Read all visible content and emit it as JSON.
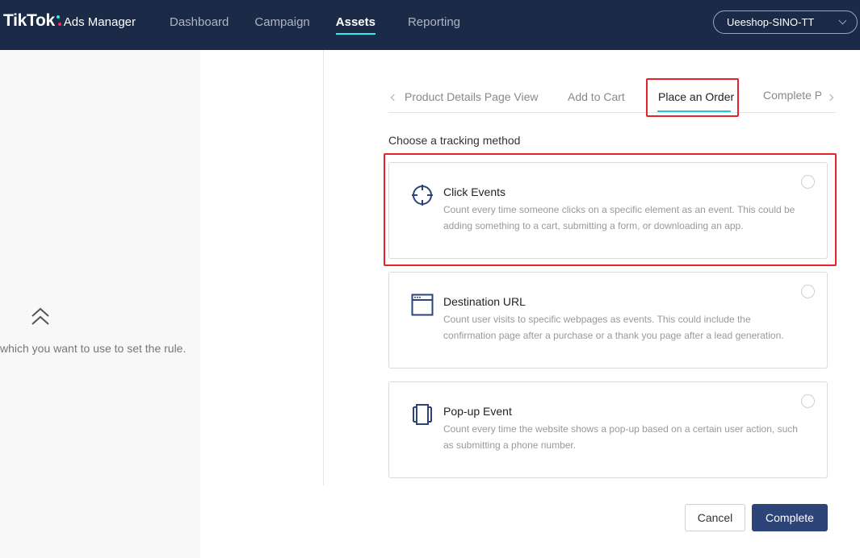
{
  "header": {
    "logo_main": "TikTok",
    "logo_sub": "Ads Manager",
    "nav": [
      {
        "label": "Dashboard"
      },
      {
        "label": "Campaign"
      },
      {
        "label": "Assets"
      },
      {
        "label": "Reporting"
      }
    ],
    "active_nav": "Assets",
    "account": "Ueeshop-SINO-TT"
  },
  "left_panel": {
    "hint": "which you want to use to set the rule."
  },
  "tabs": {
    "items": [
      {
        "label": "Product Details Page View"
      },
      {
        "label": "Add to Cart"
      },
      {
        "label": "Place an Order"
      },
      {
        "label": "Complete P"
      }
    ],
    "active": "Place an Order"
  },
  "tracking": {
    "label": "Choose a tracking method",
    "options": [
      {
        "title": "Click Events",
        "icon": "crosshair-icon",
        "desc": "Count every time someone clicks on a specific element as an event. This could be adding something to a cart, submitting a form, or downloading an app."
      },
      {
        "title": "Destination URL",
        "icon": "browser-window-icon",
        "desc": "Count user visits to specific webpages as events. This could include the confirmation page after a purchase or a thank you page after a lead generation."
      },
      {
        "title": "Pop-up Event",
        "icon": "popup-layers-icon",
        "desc": "Count every time the website shows a pop-up based on a certain user action, such as submitting a phone number."
      }
    ]
  },
  "actions": {
    "cancel": "Cancel",
    "complete": "Complete"
  },
  "colors": {
    "nav_bg": "#1b2a47",
    "accent": "#25c3d9",
    "primary_button": "#2d4478",
    "highlight_box": "#e3242b"
  }
}
